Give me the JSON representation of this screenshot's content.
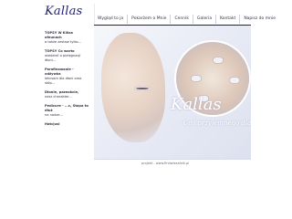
{
  "logo": {
    "text": "Kallas"
  },
  "nav": {
    "items": [
      {
        "label": "Wygląd to ja"
      },
      {
        "label": "Pokarżem o Mnie"
      },
      {
        "label": "Cennik"
      },
      {
        "label": "Galeria"
      },
      {
        "label": "Kontakt"
      },
      {
        "label": "Napisz do mnie"
      }
    ]
  },
  "sidebar": {
    "items": [
      {
        "title": "TOPSY W Killas ofeunach",
        "text": "a także zestaw tylko..."
      },
      {
        "title": "TOPSY Co warto",
        "text": "wiedzieć o pielęgnacji dłoni..."
      },
      {
        "title": "Parafinowanie - odżywka",
        "text": "lekcsom dla dłoni oraz stóp..."
      },
      {
        "title": "Dłonie, paznokcie,",
        "text": "nasz charakter..."
      },
      {
        "title": "Pedicure - ...c, Stopa to dłuż",
        "text": "na nodze..."
      },
      {
        "title": "Hatcjusi",
        "text": ""
      }
    ]
  },
  "hero": {
    "brand": "Kallas",
    "tagline": "Coś przyjemnego dla Ciebie"
  },
  "footer": {
    "text": "projekt - www.findwiesalnik.pl"
  }
}
